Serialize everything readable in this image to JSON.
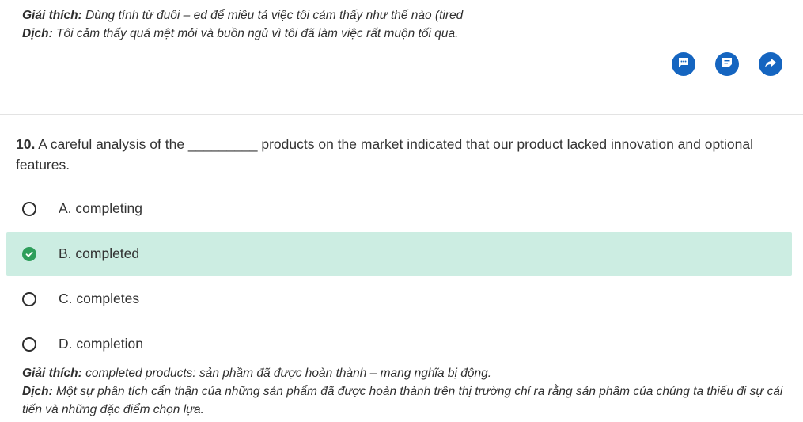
{
  "previous_explanation": {
    "explain_label": "Giải thích:",
    "explain_text": " Dùng tính từ đuôi – ed để miêu tả việc tôi cảm thấy như thế nào (tired",
    "translate_label": "Dịch:",
    "translate_text": " Tôi cảm thấy quá mệt mỏi và buồn ngủ vì tôi đã làm việc rất muộn tối qua."
  },
  "actions": {
    "icons": [
      "comment-icon",
      "note-icon",
      "share-icon"
    ],
    "color": "#1565c0"
  },
  "question": {
    "number": "10.",
    "text": " A careful analysis of the _________ products on the market indicated that our product lacked innovation and optional features."
  },
  "options": [
    {
      "label": "A. completing",
      "selected": false
    },
    {
      "label": "B. completed",
      "selected": true
    },
    {
      "label": "C. completes",
      "selected": false
    },
    {
      "label": "D. completion",
      "selected": false
    }
  ],
  "explanation": {
    "explain_label": "Giải thích:",
    "explain_text": " completed products: sản phầm đã được hoàn thành – mang nghĩa bị động.",
    "translate_label": "Dịch:",
    "translate_text": " Một sự phân tích cẩn thận của những sản phẩm đã được hoàn thành trên thị trường chỉ ra rằng sản phầm của chúng ta thiếu đi sự cải tiến và những đặc điểm chọn lựa."
  },
  "colors": {
    "selected_bg": "#ccede2",
    "correct_green": "#2e9e5b",
    "action_blue": "#1565c0"
  }
}
